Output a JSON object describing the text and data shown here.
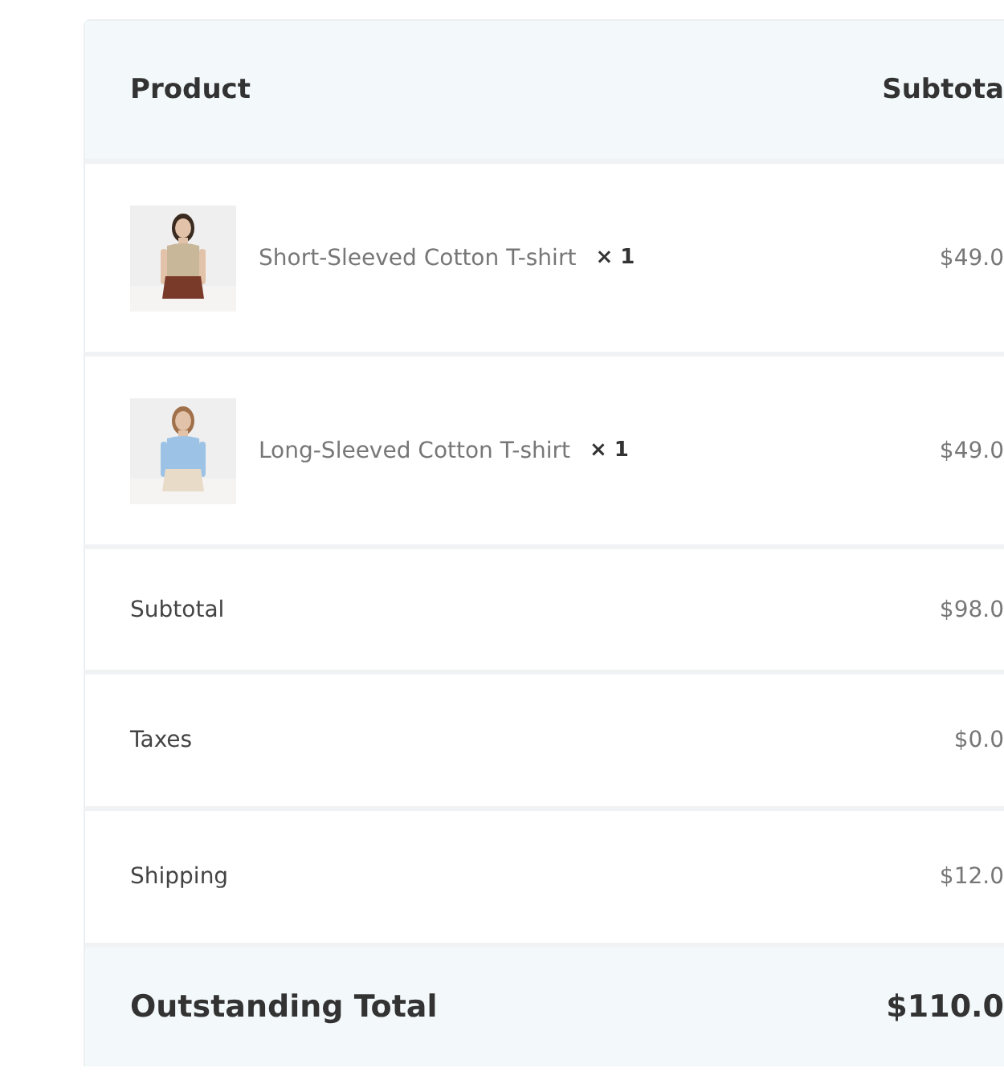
{
  "table": {
    "columns": [
      "Product",
      "Subtota"
    ],
    "items": [
      {
        "name": "Short-Sleeved Cotton T-shirt",
        "quantity": "× 1",
        "price": "$49.0"
      },
      {
        "name": "Long-Sleeved Cotton T-shirt",
        "quantity": "× 1",
        "price": "$49.0"
      }
    ],
    "summary": [
      {
        "label": "Subtotal",
        "value": "$98.0"
      },
      {
        "label": "Taxes",
        "value": "$0.0"
      },
      {
        "label": "Shipping",
        "value": "$12.0"
      }
    ],
    "total": {
      "label": "Outstanding Total",
      "value": "$110.0"
    }
  }
}
